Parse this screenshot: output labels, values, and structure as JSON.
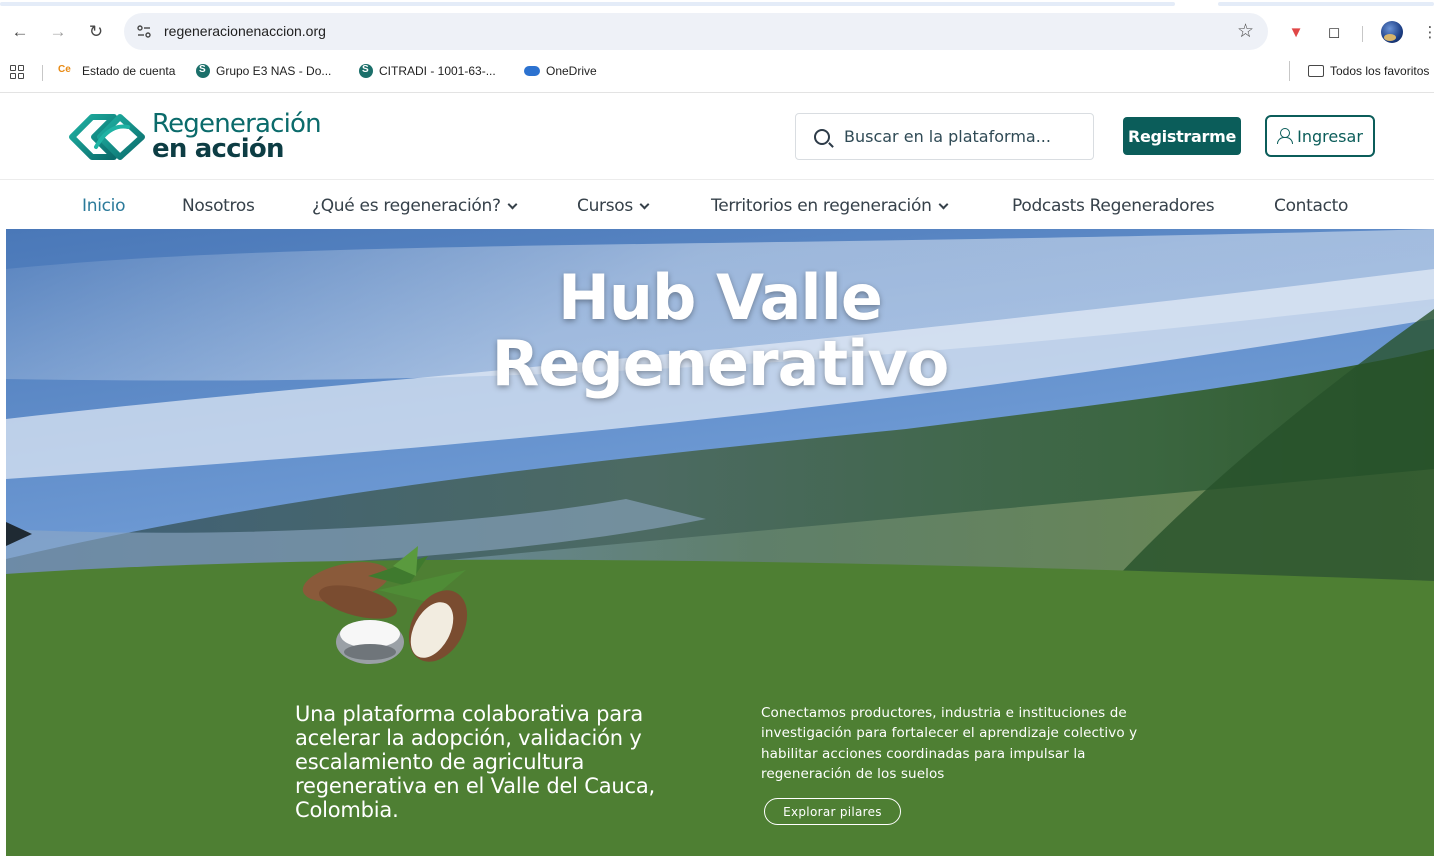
{
  "browser": {
    "url": "regeneracionenaccion.org",
    "bookmarks": [
      {
        "label": "Estado de cuenta",
        "icon": "colpensiones-icon"
      },
      {
        "label": "Grupo E3 NAS - Do...",
        "icon": "sharepoint-icon"
      },
      {
        "label": "CITRADI - 1001-63-...",
        "icon": "sharepoint-icon"
      },
      {
        "label": "OneDrive",
        "icon": "onedrive-icon"
      }
    ],
    "all_bookmarks_label": "Todos los favoritos"
  },
  "site": {
    "logo": {
      "line1": "Regeneración",
      "line2": "en acción"
    },
    "search_placeholder": "Buscar en la plataforma...",
    "register_label": "Registrarme",
    "login_label": "Ingresar",
    "brand_color": "#0b5d5a"
  },
  "nav": {
    "items": [
      {
        "label": "Inicio",
        "active": true,
        "dropdown": false
      },
      {
        "label": "Nosotros",
        "active": false,
        "dropdown": false
      },
      {
        "label": "¿Qué es regeneración?",
        "active": false,
        "dropdown": true
      },
      {
        "label": "Cursos",
        "active": false,
        "dropdown": true
      },
      {
        "label": "Territorios en regeneración",
        "active": false,
        "dropdown": true
      },
      {
        "label": "Podcasts Regeneradores",
        "active": false,
        "dropdown": false
      },
      {
        "label": "Contacto",
        "active": false,
        "dropdown": false
      }
    ]
  },
  "hero": {
    "title_line1": "Hub Valle",
    "title_line2": "Regenerativo",
    "lead": "Una plataforma colaborativa para acelerar la adopción, validación y escalamiento de agricultura regenerativa en el Valle del Cauca, Colombia.",
    "description": "Conectamos productores, industria e instituciones de investigación para fortalecer el aprendizaje colectivo y habilitar acciones coordinadas para impulsar la regeneración de los suelos",
    "cta_label": "Explorar pilares",
    "green_color": "#4e7f33"
  }
}
